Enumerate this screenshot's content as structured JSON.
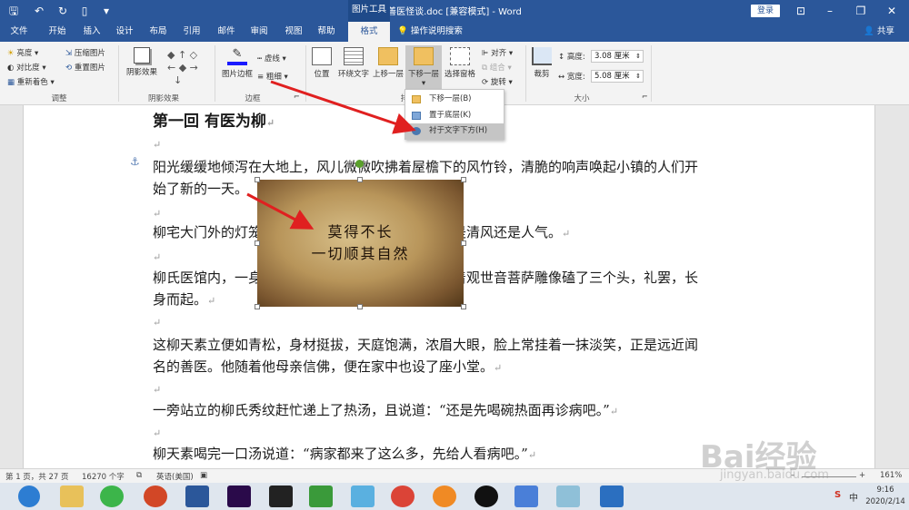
{
  "titlebar": {
    "title": "善医怪谈.doc [兼容模式] - Word",
    "context_tab": "图片工具",
    "login_label": "登录"
  },
  "tabs": [
    "文件",
    "开始",
    "插入",
    "设计",
    "布局",
    "引用",
    "邮件",
    "审阅",
    "视图",
    "帮助",
    "格式"
  ],
  "active_tab": "格式",
  "tellme_label": "操作说明搜索",
  "share_label": "共享",
  "ribbon": {
    "adjust": {
      "brightness": "亮度",
      "contrast": "对比度",
      "recolor": "重新着色",
      "compress": "压缩图片",
      "reset": "重置图片",
      "group_label": "调整"
    },
    "shadow": {
      "shadow_effects": "阴影效果",
      "group_label": "阴影效果"
    },
    "border": {
      "picture_border": "图片边框",
      "dashes": "虚线",
      "weight": "粗细",
      "group_label": "边框"
    },
    "arrange": {
      "position": "位置",
      "wrap_text": "环绕文字",
      "bring_forward": "上移一层",
      "send_backward": "下移一层",
      "selection_pane": "选择窗格",
      "align": "对齐",
      "group": "组合",
      "rotate": "旋转",
      "group_label_fragment": "排"
    },
    "size": {
      "crop": "裁剪",
      "height_label": "高度:",
      "height_value": "3.08 厘米",
      "width_label": "宽度:",
      "width_value": "5.08 厘米",
      "group_label": "大小"
    }
  },
  "menu": {
    "items": [
      "下移一层(B)",
      "置于底层(K)",
      "衬于文字下方(H)"
    ],
    "highlighted_index": 2
  },
  "document": {
    "paragraphs": [
      "第一回  有医为柳",
      "",
      "阳光缓缓地倾泻在大地上，风儿微微吹拂着屋檐下的风竹铃，清脆的响声唤起小镇的人们开",
      "始了新的一天。",
      "",
      "柳宅大门外的灯笼也在微微摇晃着，不知摆弄它的是清风还是人气。",
      "",
      "柳氏医馆内，一身棕色长袍的柳天素恭恭敬敬地对着观世音菩萨雕像磕了三个头，礼罢，长",
      "身而起。",
      "",
      "这柳天素立便如青松，身材挺拔，天庭饱满，浓眉大眼，脸上常挂着一抹淡笑，正是远近闻",
      "名的善医。他随着他母亲信佛，便在家中也设了座小堂。",
      "",
      "一旁站立的柳氏秀纹赶忙递上了热汤，且说道：“还是先喝碗热面再诊病吧。”",
      "",
      "柳天素喝完一口汤说道：“病家都来了这么多，先给人看病吧。”"
    ],
    "paragraph_mark": "↵",
    "anchor_symbol": "⚓",
    "picture_text": [
      "莫得不长",
      "一切顺其自然"
    ]
  },
  "statusbar": {
    "page": "第 1 页，共 27 页",
    "words": "16270 个字",
    "language": "英语(美国)",
    "zoom": "161%"
  },
  "taskbar": {
    "time": "9:16",
    "date": "2020/2/14"
  },
  "watermark": {
    "logo": "Bai经验",
    "url": "jingyan.baidu.com"
  },
  "colors": {
    "accent": "#2b579a",
    "arrow": "#e02020"
  }
}
